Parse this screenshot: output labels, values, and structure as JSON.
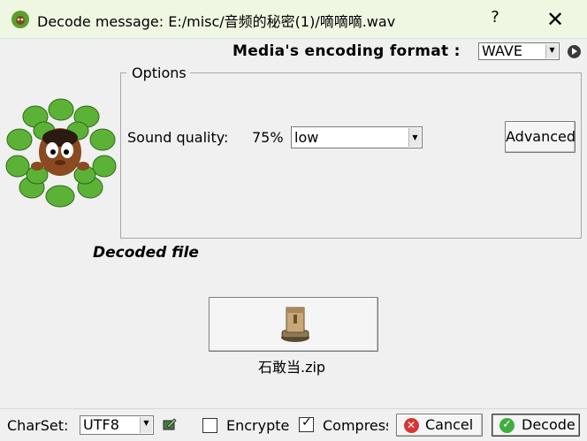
{
  "window": {
    "title": "Decode message: E:/misc/音频的秘密(1)/嘀嘀嘀.wav",
    "help_glyph": "?",
    "close_glyph": "✕",
    "icon": "leaf-character-icon"
  },
  "format": {
    "label": "Media's encoding format :",
    "selected": "WAVE",
    "play_icon": "play-icon"
  },
  "options": {
    "legend": "Options",
    "sound_quality_label": "Sound quality:",
    "sound_quality_value": "75%",
    "quality_selected": "low",
    "advanced_label": "Advanced"
  },
  "decoded": {
    "label": "Decoded file",
    "file_icon": "archive-box-icon",
    "file_name": "石敢当.zip"
  },
  "bottom": {
    "charset_label": "CharSet:",
    "charset_selected": "UTF8",
    "charset_tool_icon": "edit-icon",
    "encrypted_label": "Encrypted",
    "encrypted_checked": false,
    "compress_label": "Compressed",
    "compress_checked": true,
    "cancel_label": "Cancel",
    "decode_label": "Decode"
  },
  "colors": {
    "titlebar_bg": "#eff7e3",
    "window_bg": "#f0f0f0",
    "cancel_icon": "#d93434",
    "decode_icon": "#3fae3f"
  }
}
